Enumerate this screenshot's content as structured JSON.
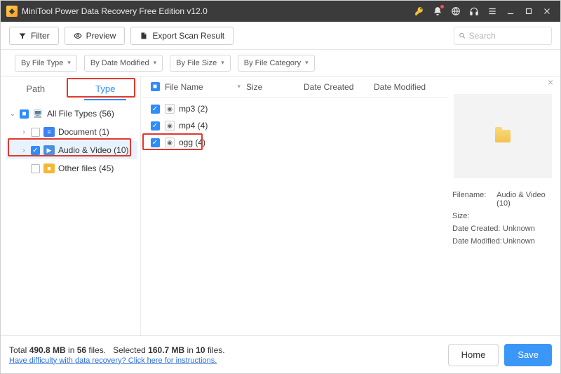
{
  "title": "MiniTool Power Data Recovery Free Edition v12.0",
  "toolbar": {
    "filter": "Filter",
    "preview": "Preview",
    "export": "Export Scan Result",
    "search_placeholder": "Search"
  },
  "filters": {
    "type": "By File Type",
    "date": "By Date Modified",
    "size": "By File Size",
    "category": "By File Category"
  },
  "tabs": {
    "path": "Path",
    "type": "Type"
  },
  "tree": {
    "root": "All File Types (56)",
    "doc": "Document (1)",
    "av": "Audio & Video (10)",
    "other": "Other files (45)"
  },
  "cols": {
    "name": "File Name",
    "size": "Size",
    "created": "Date Created",
    "modified": "Date Modified"
  },
  "rows": {
    "mp3": "mp3 (2)",
    "mp4": "mp4 (4)",
    "ogg": "ogg (4)"
  },
  "detail": {
    "filename_k": "Filename:",
    "filename_v": "Audio & Video (10)",
    "size_k": "Size:",
    "size_v": "",
    "created_k": "Date Created:",
    "created_v": "Unknown",
    "modified_k": "Date Modified:",
    "modified_v": "Unknown"
  },
  "status": {
    "total_pre": "Total ",
    "total_size": "490.8 MB",
    "total_mid": " in ",
    "total_files": "56",
    "total_suf": " files.",
    "sel_pre": "Selected ",
    "sel_size": "160.7 MB",
    "sel_mid": " in ",
    "sel_files": "10",
    "sel_suf": " files.",
    "help": "Have difficulty with data recovery? Click here for instructions.",
    "home": "Home",
    "save": "Save"
  }
}
